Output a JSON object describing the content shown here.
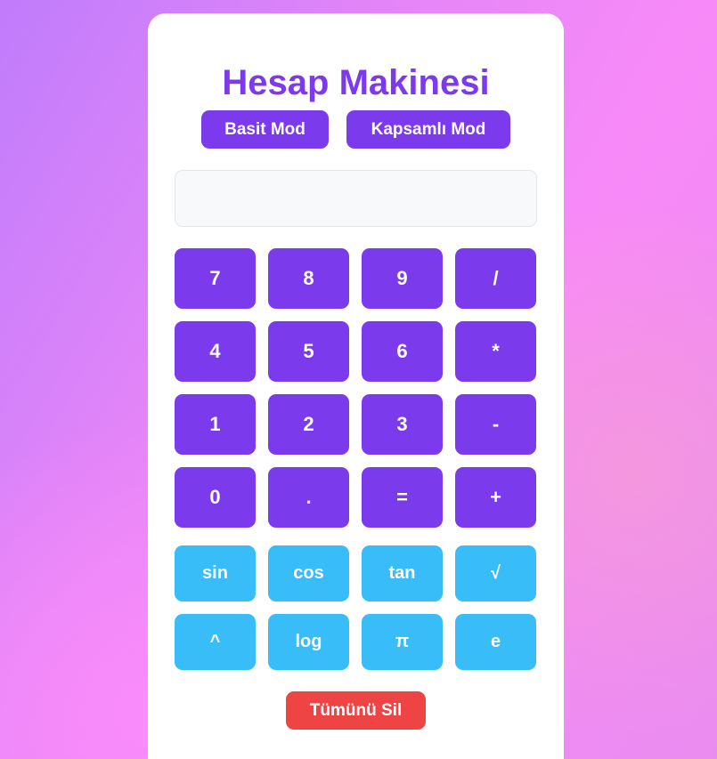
{
  "app": {
    "title": "Hesap Makinesi"
  },
  "modes": {
    "basic_label": "Basit Mod",
    "full_label": "Kapsamlı Mod"
  },
  "display": {
    "value": "",
    "placeholder": ""
  },
  "basic_keys": [
    "7",
    "8",
    "9",
    "/",
    "4",
    "5",
    "6",
    "*",
    "1",
    "2",
    "3",
    "-",
    "0",
    ".",
    "=",
    "+"
  ],
  "scientific_keys": [
    "sin",
    "cos",
    "tan",
    "√",
    "^",
    "log",
    "π",
    "e"
  ],
  "clear": {
    "label": "Tümünü Sil"
  },
  "colors": {
    "primary": "#7c3aed",
    "scientific": "#38bdf8",
    "danger": "#ef4444"
  }
}
